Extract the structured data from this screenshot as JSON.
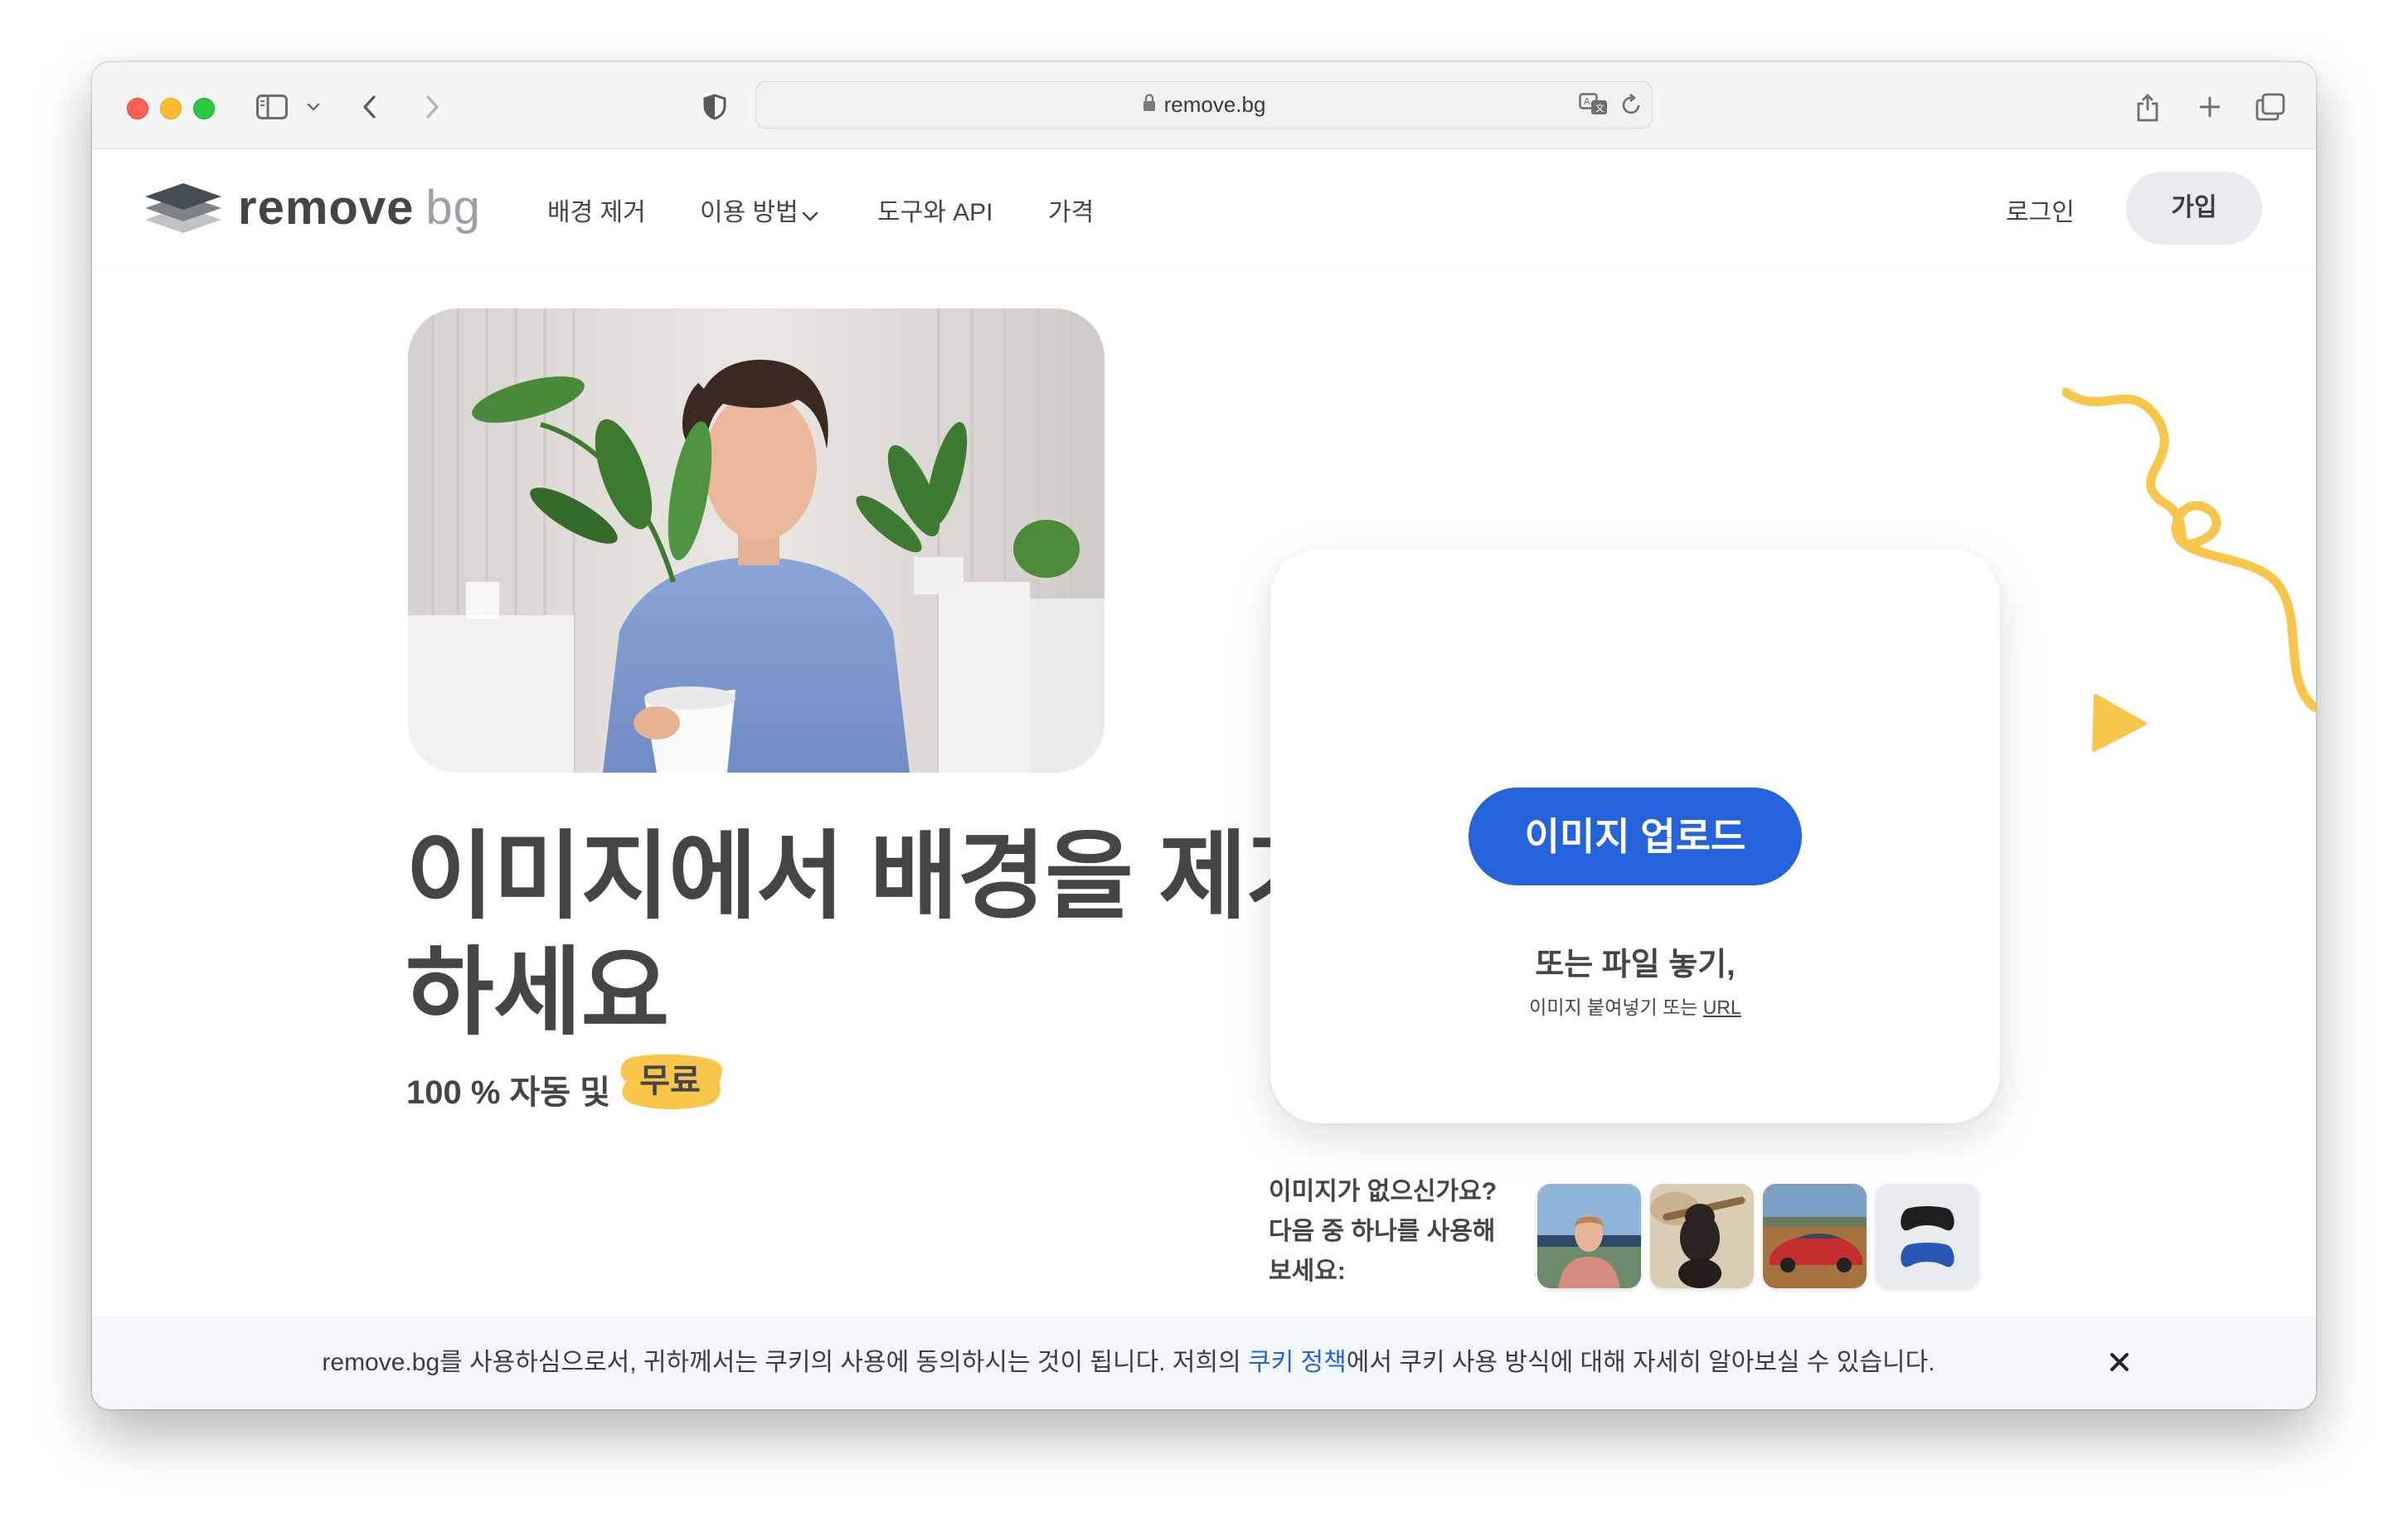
{
  "browser": {
    "url": "remove.bg",
    "traffic_lights": [
      "close",
      "minimize",
      "zoom"
    ],
    "icons": [
      "sidebar-icon",
      "chevron-down-icon",
      "back-icon",
      "forward-icon",
      "shield-icon",
      "lock-icon",
      "translate-icon",
      "reload-icon",
      "share-icon",
      "new-tab-icon",
      "tabs-overview-icon"
    ]
  },
  "nav": {
    "logo_main": "remove",
    "logo_accent": "bg",
    "links": [
      "배경 제거",
      "이용 방법",
      "도구와 API",
      "가격"
    ],
    "login": "로그인",
    "signup": "가입"
  },
  "hero": {
    "headline": "이미지에서 배경을 제거하세요",
    "subline": "100 % 자동 및",
    "free_badge": "무료"
  },
  "upload": {
    "button": "이미지 업로드",
    "drop": "또는 파일 놓기,",
    "paste": "이미지 붙여넣기 또는",
    "url": "URL"
  },
  "samples": {
    "prompt": "이미지가 없으신가요? 다음 중 하나를 사용해 보세요:",
    "thumbnails": [
      "man-outdoors",
      "dog-with-stick",
      "red-car",
      "game-controllers"
    ]
  },
  "cookie": {
    "before": "remove.bg를 사용하심으로서, 귀하께서는 쿠키의 사용에 동의하시는 것이 됩니다. 저희의 ",
    "policy": "쿠키 정책",
    "after": "에서 쿠키 사용 방식에 대해 자세히 알아보실 수 있습니다."
  },
  "colors": {
    "primary": "#2563dd",
    "accent_yellow": "#f7c64a",
    "text": "#454545",
    "cookie_bg": "#f1f7fb"
  }
}
